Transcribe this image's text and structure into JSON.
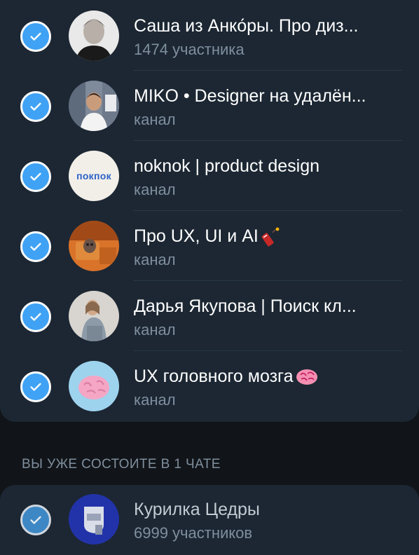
{
  "selected_chats": [
    {
      "title": "Саша из Анко́ры. Про диз...",
      "subtitle": "1474 участника",
      "avatar": "person-avatar"
    },
    {
      "title": "MIKO • Designer на удалён...",
      "subtitle": "канал",
      "avatar": "photo-avatar"
    },
    {
      "title": "noknok | product design",
      "subtitle": "канал",
      "avatar": "logo-avatar",
      "logo_text": "покпок"
    },
    {
      "title": "Про UX, UI и AI",
      "subtitle": "канал",
      "avatar": "robot-avatar",
      "emoji": "firecracker-icon"
    },
    {
      "title": "Дарья Якупова | Поиск кл...",
      "subtitle": "канал",
      "avatar": "person-avatar"
    },
    {
      "title": "UX головного мозга",
      "subtitle": "канал",
      "avatar": "brain-avatar",
      "emoji": "brain-icon"
    }
  ],
  "section_label": "ВЫ УЖЕ СОСТОИТЕ В 1 ЧАТЕ",
  "joined_chats": [
    {
      "title": "Курилка Цедры",
      "subtitle": "6999 участников",
      "avatar": "group-avatar"
    }
  ],
  "colors": {
    "checkbox": "#3fa2f4",
    "card": "#1c2733",
    "background": "#111418",
    "subtitle": "#7f8f9e"
  }
}
